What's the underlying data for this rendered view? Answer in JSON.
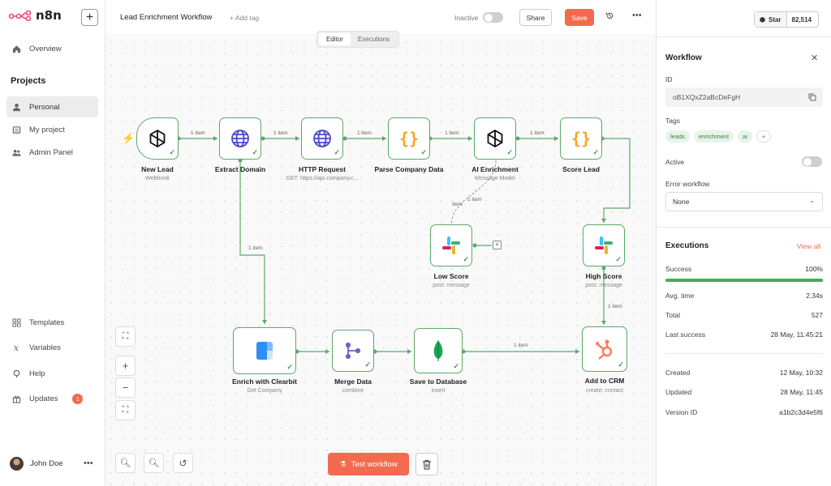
{
  "app": {
    "name": "n8n"
  },
  "sidebar": {
    "nav": [
      {
        "label": "Overview",
        "icon": "home-icon"
      }
    ],
    "projects_heading": "Projects",
    "projects": [
      {
        "label": "Personal",
        "icon": "user-icon"
      },
      {
        "label": "My project",
        "icon": "layers-icon"
      },
      {
        "label": "Admin Panel",
        "icon": "users-icon"
      }
    ],
    "bottom": [
      {
        "label": "Templates",
        "icon": "templates-icon"
      },
      {
        "label": "Variables",
        "icon": "variables-icon"
      },
      {
        "label": "Help",
        "icon": "help-icon"
      },
      {
        "label": "Updates",
        "icon": "gift-icon",
        "badge": "1"
      }
    ],
    "user": {
      "name": "John Doe"
    }
  },
  "topbar": {
    "workflow_name": "Lead Enrichment Workflow",
    "add_tag": "+ Add tag",
    "status_label": "Inactive",
    "share_label": "Share",
    "save_label": "Save"
  },
  "canvas": {
    "tabs": [
      {
        "label": "Editor"
      },
      {
        "label": "Executions"
      }
    ],
    "nodes": {
      "new_lead": {
        "label": "New Lead",
        "sub": "Webhook"
      },
      "extract_domain": {
        "label": "Extract Domain",
        "sub": ""
      },
      "http_request": {
        "label": "HTTP Request",
        "sub": "GET: https://api.company.c..."
      },
      "parse_company": {
        "label": "Parse Company Data",
        "sub": ""
      },
      "ai_enrichment": {
        "label": "AI Enrichment",
        "sub": "Message Model"
      },
      "score_lead": {
        "label": "Score Lead",
        "sub": ""
      },
      "low_score": {
        "label": "Low Score",
        "sub": "post: message"
      },
      "high_score": {
        "label": "High Score",
        "sub": "post: message"
      },
      "enrich_clearbit": {
        "label": "Enrich with Clearbit",
        "sub": "Get Company"
      },
      "merge_data": {
        "label": "Merge Data",
        "sub": "combine"
      },
      "save_db": {
        "label": "Save to Database",
        "sub": "insert"
      },
      "add_crm": {
        "label": "Add to CRM",
        "sub": "create: contact"
      }
    },
    "connection_labels": {
      "l1": "1 item",
      "l2": "1 item",
      "l3": "1 item",
      "l4": "1 item",
      "l5": "1 item",
      "l6": "1 item",
      "l7": "1 item",
      "l8": "1 item",
      "l9": "Item"
    },
    "test_button": "Test workflow"
  },
  "panel": {
    "github": {
      "star_label": "Star",
      "star_count": "82,514"
    },
    "workflow_title": "Workflow",
    "id_label": "ID",
    "id_value": "oB1XQxZ2aBcDeFgH",
    "tags_label": "Tags",
    "tags": [
      "leads",
      "enrichment",
      "ai"
    ],
    "active_label": "Active",
    "error_workflow_label": "Error workflow",
    "error_workflow_value": "None",
    "executions_title": "Executions",
    "view_all": "View all",
    "success_rate_fraction": 1.0,
    "stats": [
      {
        "label": "Success",
        "value": "100%"
      },
      {
        "label": "Avg. time",
        "value": "2.34s"
      },
      {
        "label": "Total",
        "value": "527"
      },
      {
        "label": "Last success",
        "value": "28 May, 11:45:21"
      }
    ],
    "meta": [
      {
        "label": "Created",
        "value": "12 May, 10:32"
      },
      {
        "label": "Updated",
        "value": "28 May, 11:45"
      },
      {
        "label": "Version ID",
        "value": "a1b2c3d4e5f6"
      }
    ]
  },
  "colors": {
    "accent": "#f26b4f",
    "node_border": "#5ca869",
    "success": "#46ad5b"
  }
}
